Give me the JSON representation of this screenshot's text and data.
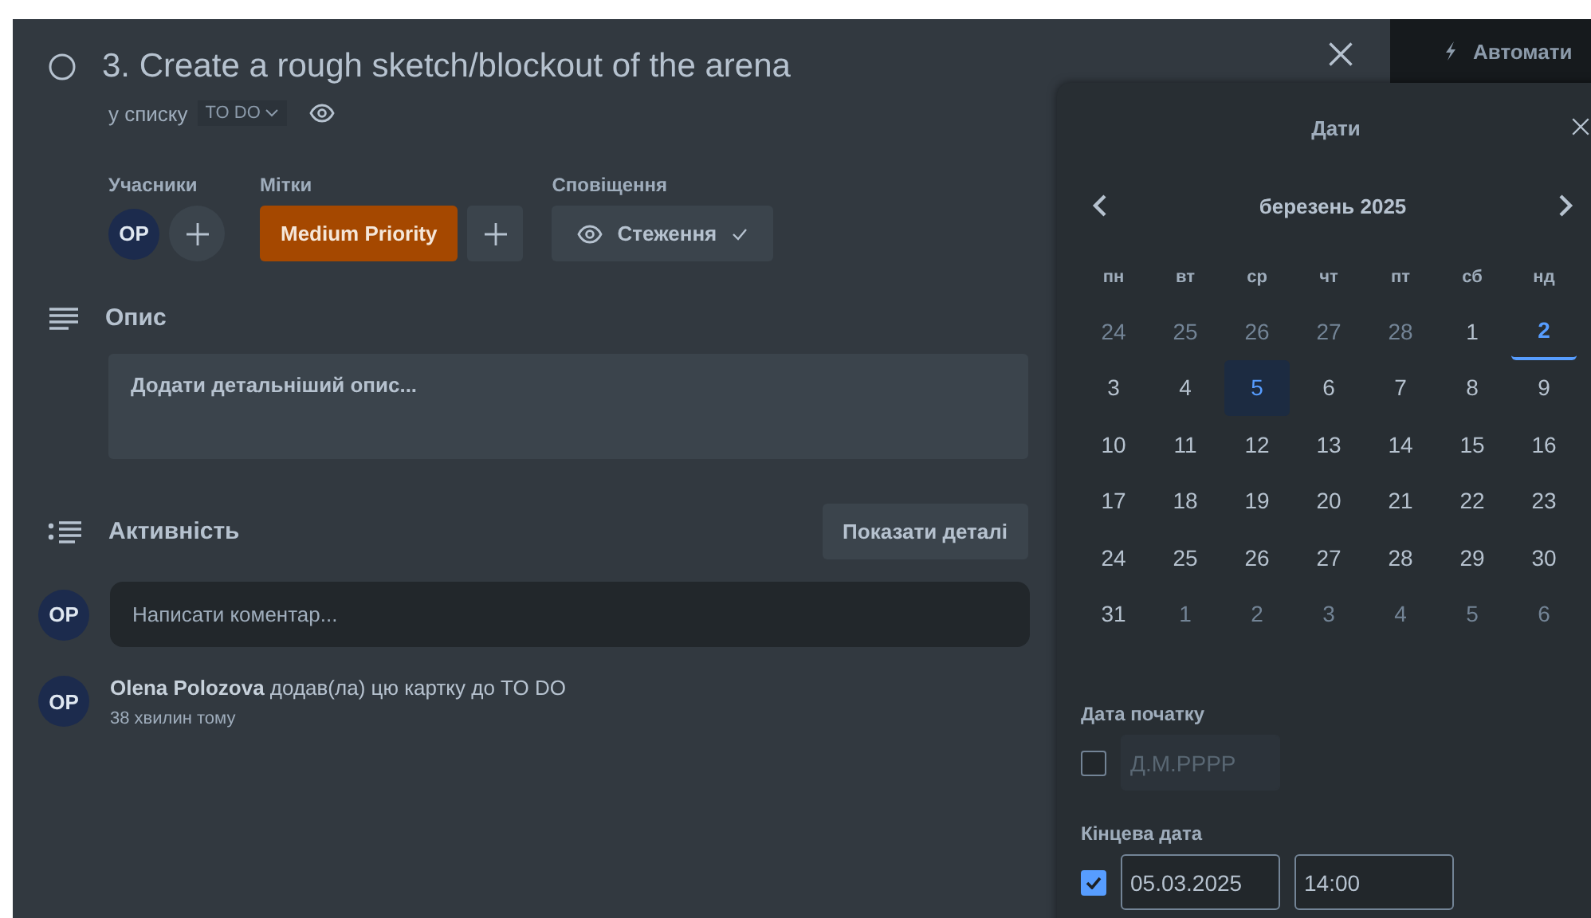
{
  "card": {
    "title": "3. Create a rough sketch/blockout of the arena",
    "completed": false,
    "list_prefix": "у списку",
    "list_name": "TO DO",
    "members": {
      "label": "Учасники",
      "avatars": [
        "OP"
      ]
    },
    "labels": {
      "label": "Мітки",
      "items": [
        {
          "text": "Medium Priority",
          "color": "#a54800"
        }
      ]
    },
    "notifications": {
      "label": "Сповіщення",
      "button": "Стеження",
      "watching": true
    },
    "description": {
      "heading": "Опис",
      "placeholder": "Додати детальніший опис..."
    },
    "activity": {
      "heading": "Активність",
      "details_button": "Показати деталі",
      "comment_avatar": "OP",
      "comment_placeholder": "Написати коментар...",
      "items": [
        {
          "avatar": "OP",
          "text": "**Olena Polozova** додав(ла) цю картку до TO DO",
          "time": "38 хвилин тому"
        }
      ]
    }
  },
  "side_button": {
    "label": "Автомати"
  },
  "dates": {
    "title": "Дати",
    "month": "березень 2025",
    "weekdays": [
      "пн",
      "вт",
      "ср",
      "чт",
      "пт",
      "сб",
      "нд"
    ],
    "weeks": [
      [
        {
          "d": "24",
          "outside": true,
          "selected": false,
          "today": false
        },
        {
          "d": "25",
          "outside": true,
          "selected": false,
          "today": false
        },
        {
          "d": "26",
          "outside": true,
          "selected": false,
          "today": false
        },
        {
          "d": "27",
          "outside": true,
          "selected": false,
          "today": false
        },
        {
          "d": "28",
          "outside": true,
          "selected": false,
          "today": false
        },
        {
          "d": "1",
          "outside": false,
          "selected": false,
          "today": false
        },
        {
          "d": "2",
          "outside": false,
          "selected": false,
          "today": true
        }
      ],
      [
        {
          "d": "3",
          "outside": false,
          "selected": false,
          "today": false
        },
        {
          "d": "4",
          "outside": false,
          "selected": false,
          "today": false
        },
        {
          "d": "5",
          "outside": false,
          "selected": true,
          "today": false
        },
        {
          "d": "6",
          "outside": false,
          "selected": false,
          "today": false
        },
        {
          "d": "7",
          "outside": false,
          "selected": false,
          "today": false
        },
        {
          "d": "8",
          "outside": false,
          "selected": false,
          "today": false
        },
        {
          "d": "9",
          "outside": false,
          "selected": false,
          "today": false
        }
      ],
      [
        {
          "d": "10",
          "outside": false,
          "selected": false,
          "today": false
        },
        {
          "d": "11",
          "outside": false,
          "selected": false,
          "today": false
        },
        {
          "d": "12",
          "outside": false,
          "selected": false,
          "today": false
        },
        {
          "d": "13",
          "outside": false,
          "selected": false,
          "today": false
        },
        {
          "d": "14",
          "outside": false,
          "selected": false,
          "today": false
        },
        {
          "d": "15",
          "outside": false,
          "selected": false,
          "today": false
        },
        {
          "d": "16",
          "outside": false,
          "selected": false,
          "today": false
        }
      ],
      [
        {
          "d": "17",
          "outside": false,
          "selected": false,
          "today": false
        },
        {
          "d": "18",
          "outside": false,
          "selected": false,
          "today": false
        },
        {
          "d": "19",
          "outside": false,
          "selected": false,
          "today": false
        },
        {
          "d": "20",
          "outside": false,
          "selected": false,
          "today": false
        },
        {
          "d": "21",
          "outside": false,
          "selected": false,
          "today": false
        },
        {
          "d": "22",
          "outside": false,
          "selected": false,
          "today": false
        },
        {
          "d": "23",
          "outside": false,
          "selected": false,
          "today": false
        }
      ],
      [
        {
          "d": "24",
          "outside": false,
          "selected": false,
          "today": false
        },
        {
          "d": "25",
          "outside": false,
          "selected": false,
          "today": false
        },
        {
          "d": "26",
          "outside": false,
          "selected": false,
          "today": false
        },
        {
          "d": "27",
          "outside": false,
          "selected": false,
          "today": false
        },
        {
          "d": "28",
          "outside": false,
          "selected": false,
          "today": false
        },
        {
          "d": "29",
          "outside": false,
          "selected": false,
          "today": false
        },
        {
          "d": "30",
          "outside": false,
          "selected": false,
          "today": false
        }
      ],
      [
        {
          "d": "31",
          "outside": false,
          "selected": false,
          "today": false
        },
        {
          "d": "1",
          "outside": true,
          "selected": false,
          "today": false
        },
        {
          "d": "2",
          "outside": true,
          "selected": false,
          "today": false
        },
        {
          "d": "3",
          "outside": true,
          "selected": false,
          "today": false
        },
        {
          "d": "4",
          "outside": true,
          "selected": false,
          "today": false
        },
        {
          "d": "5",
          "outside": true,
          "selected": false,
          "today": false
        },
        {
          "d": "6",
          "outside": true,
          "selected": false,
          "today": false
        }
      ]
    ],
    "start": {
      "label": "Дата початку",
      "checked": false,
      "placeholder": "Д.М.РРРР"
    },
    "due": {
      "label": "Кінцева дата",
      "checked": true,
      "date": "05.03.2025",
      "time": "14:00"
    }
  }
}
